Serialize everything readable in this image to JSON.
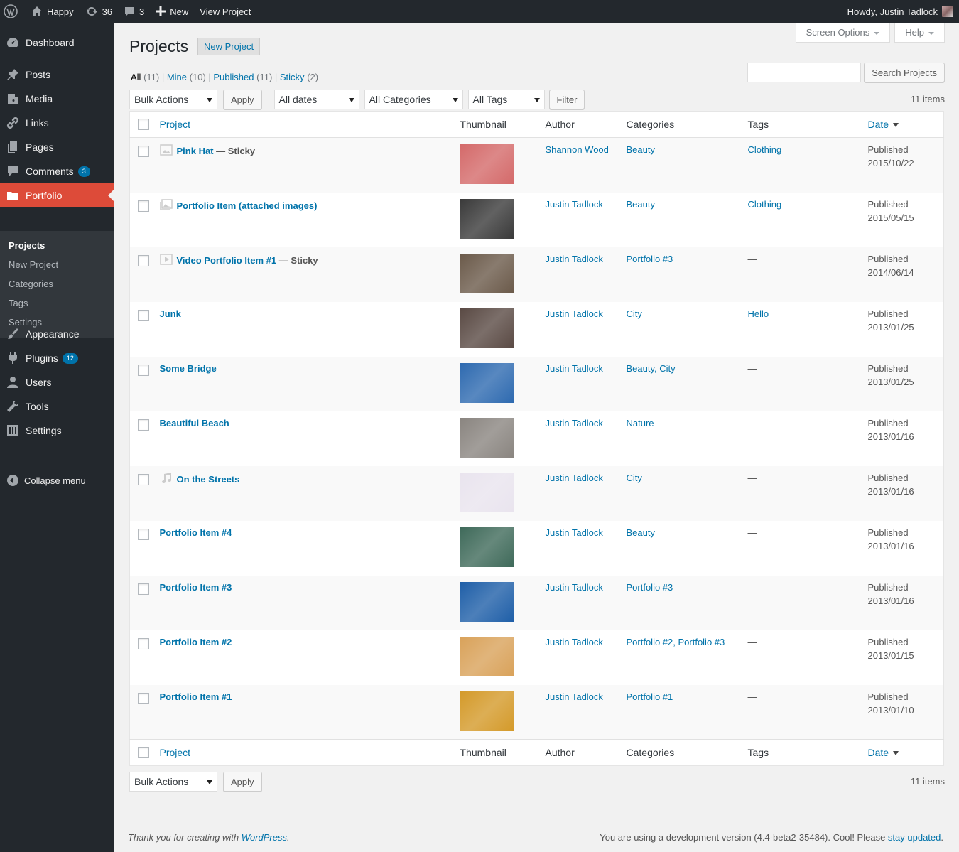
{
  "adminbar": {
    "site_name": "Happy",
    "updates_count": "36",
    "comments_count": "3",
    "new_label": "New",
    "view_label": "View Project",
    "howdy": "Howdy, Justin Tadlock"
  },
  "sidebar": {
    "items": [
      {
        "label": "Dashboard",
        "icon": "dashboard-icon"
      },
      {
        "label": "Posts",
        "icon": "pin-icon"
      },
      {
        "label": "Media",
        "icon": "media-icon"
      },
      {
        "label": "Links",
        "icon": "link-icon"
      },
      {
        "label": "Pages",
        "icon": "pages-icon"
      },
      {
        "label": "Comments",
        "icon": "comment-icon",
        "badge": "3"
      },
      {
        "label": "Portfolio",
        "icon": "folder-icon",
        "active": true
      },
      {
        "label": "Appearance",
        "icon": "brush-icon"
      },
      {
        "label": "Plugins",
        "icon": "plug-icon",
        "badge": "12"
      },
      {
        "label": "Users",
        "icon": "user-icon"
      },
      {
        "label": "Tools",
        "icon": "wrench-icon"
      },
      {
        "label": "Settings",
        "icon": "settings-icon"
      }
    ],
    "submenu": [
      "Projects",
      "New Project",
      "Categories",
      "Tags",
      "Settings"
    ],
    "collapse_label": "Collapse menu"
  },
  "screen_options": "Screen Options",
  "help": "Help",
  "page_title": "Projects",
  "add_new": "New Project",
  "views": [
    {
      "label": "All",
      "count": "(11)"
    },
    {
      "label": "Mine",
      "count": "(10)"
    },
    {
      "label": "Published",
      "count": "(11)"
    },
    {
      "label": "Sticky",
      "count": "(2)"
    }
  ],
  "search_button": "Search Projects",
  "filters": {
    "bulk_actions": "Bulk Actions",
    "apply": "Apply",
    "dates": "All dates",
    "categories": "All Categories",
    "tags": "All Tags",
    "filter": "Filter"
  },
  "items_count": "11 items",
  "columns": {
    "project": "Project",
    "thumbnail": "Thumbnail",
    "author": "Author",
    "categories": "Categories",
    "tags": "Tags",
    "date": "Date"
  },
  "rows": [
    {
      "title": "Pink Hat",
      "state": "— Sticky",
      "format": "image",
      "author": "Shannon Wood",
      "categories": "Beauty",
      "tags": "Clothing",
      "status": "Published",
      "date": "2015/10/22",
      "thumb": "#d46a6a"
    },
    {
      "title": "Portfolio Item (attached images)",
      "state": "",
      "format": "gallery",
      "author": "Justin Tadlock",
      "categories": "Beauty",
      "tags": "Clothing",
      "status": "Published",
      "date": "2015/05/15",
      "thumb": "#3a3a3a"
    },
    {
      "title": "Video Portfolio Item #1",
      "state": "— Sticky",
      "format": "video",
      "author": "Justin Tadlock",
      "categories": "Portfolio #3",
      "tags": "—",
      "status": "Published",
      "date": "2014/06/14",
      "thumb": "#6b5a4a"
    },
    {
      "title": "Junk",
      "state": "",
      "format": "",
      "author": "Justin Tadlock",
      "categories": "City",
      "tags": "Hello",
      "status": "Published",
      "date": "2013/01/25",
      "thumb": "#5a4a44"
    },
    {
      "title": "Some Bridge",
      "state": "",
      "format": "",
      "author": "Justin Tadlock",
      "categories": "Beauty, City",
      "tags": "—",
      "status": "Published",
      "date": "2013/01/25",
      "thumb": "#2e6ab0"
    },
    {
      "title": "Beautiful Beach",
      "state": "",
      "format": "",
      "author": "Justin Tadlock",
      "categories": "Nature",
      "tags": "—",
      "status": "Published",
      "date": "2013/01/16",
      "thumb": "#8a8580"
    },
    {
      "title": "On the Streets",
      "state": "",
      "format": "audio",
      "author": "Justin Tadlock",
      "categories": "City",
      "tags": "—",
      "status": "Published",
      "date": "2013/01/16",
      "thumb": "#e9e4ee"
    },
    {
      "title": "Portfolio Item #4",
      "state": "",
      "format": "",
      "author": "Justin Tadlock",
      "categories": "Beauty",
      "tags": "—",
      "status": "Published",
      "date": "2013/01/16",
      "thumb": "#3f6a5a"
    },
    {
      "title": "Portfolio Item #3",
      "state": "",
      "format": "",
      "author": "Justin Tadlock",
      "categories": "Portfolio #3",
      "tags": "—",
      "status": "Published",
      "date": "2013/01/16",
      "thumb": "#1f5fa8"
    },
    {
      "title": "Portfolio Item #2",
      "state": "",
      "format": "",
      "author": "Justin Tadlock",
      "categories": "Portfolio #2, Portfolio #3",
      "tags": "—",
      "status": "Published",
      "date": "2013/01/15",
      "thumb": "#d9a25a"
    },
    {
      "title": "Portfolio Item #1",
      "state": "",
      "format": "",
      "author": "Justin Tadlock",
      "categories": "Portfolio #1",
      "tags": "—",
      "status": "Published",
      "date": "2013/01/10",
      "thumb": "#d49a2a"
    }
  ],
  "footer": {
    "thanks_prefix": "Thank you for creating with ",
    "thanks_link": "WordPress",
    "thanks_suffix": ".",
    "version_prefix": "You are using a development version (4.4-beta2-35484). Cool! Please ",
    "version_link": "stay updated",
    "version_suffix": "."
  }
}
